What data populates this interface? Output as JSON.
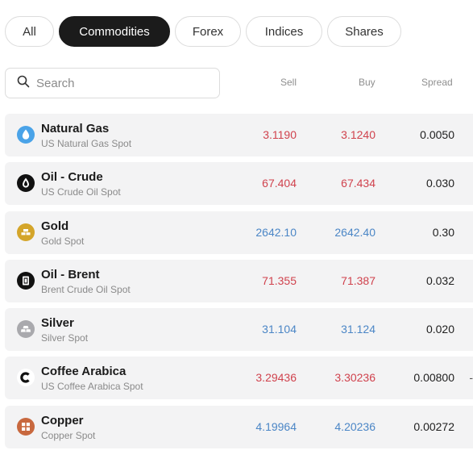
{
  "tabs": [
    {
      "label": "All",
      "active": false
    },
    {
      "label": "Commodities",
      "active": true
    },
    {
      "label": "Forex",
      "active": false
    },
    {
      "label": "Indices",
      "active": false
    },
    {
      "label": "Shares",
      "active": false
    }
  ],
  "search": {
    "placeholder": "Search"
  },
  "columns": {
    "sell": "Sell",
    "buy": "Buy",
    "spread": "Spread"
  },
  "colors": {
    "down": "#d0424d",
    "up": "#4b86c6",
    "active_tab": "#1b1b1b",
    "row_bg": "#f3f3f4"
  },
  "instruments": [
    {
      "name": "Natural Gas",
      "sub": "US Natural Gas Spot",
      "sell": "3.1190",
      "buy": "3.1240",
      "spread": "0.0050",
      "direction": "down",
      "icon": "water-drop-icon",
      "icon_color": "#4aa3e8"
    },
    {
      "name": "Oil - Crude",
      "sub": "US Crude Oil Spot",
      "sell": "67.404",
      "buy": "67.434",
      "spread": "0.030",
      "direction": "down",
      "icon": "oil-drop-icon",
      "icon_color": "#111111"
    },
    {
      "name": "Gold",
      "sub": "Gold Spot",
      "sell": "2642.10",
      "buy": "2642.40",
      "spread": "0.30",
      "direction": "up",
      "icon": "gold-bars-icon",
      "icon_color": "#d4a52a"
    },
    {
      "name": "Oil - Brent",
      "sub": "Brent Crude Oil Spot",
      "sell": "71.355",
      "buy": "71.387",
      "spread": "0.032",
      "direction": "down",
      "icon": "oil-barrel-icon",
      "icon_color": "#111111"
    },
    {
      "name": "Silver",
      "sub": "Silver Spot",
      "sell": "31.104",
      "buy": "31.124",
      "spread": "0.020",
      "direction": "up",
      "icon": "silver-bars-icon",
      "icon_color": "#a9a9ad"
    },
    {
      "name": "Coffee Arabica",
      "sub": "US Coffee Arabica Spot",
      "sell": "3.29436",
      "buy": "3.30236",
      "spread": "0.00800",
      "direction": "down",
      "icon": "coffee-bean-icon",
      "icon_color": "#111111",
      "trailing": "-"
    },
    {
      "name": "Copper",
      "sub": "Copper Spot",
      "sell": "4.19964",
      "buy": "4.20236",
      "spread": "0.00272",
      "direction": "up",
      "icon": "copper-block-icon",
      "icon_color": "#c8683e"
    }
  ]
}
